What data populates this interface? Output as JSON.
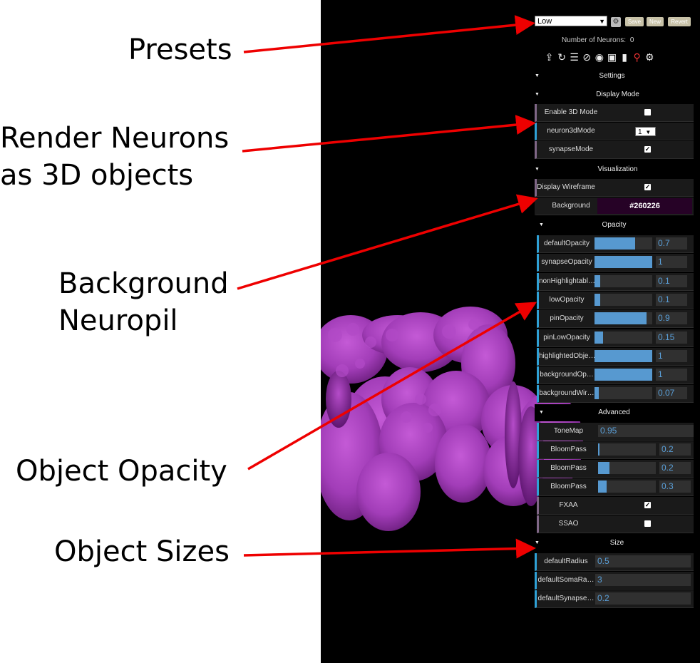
{
  "annotations": {
    "presets": "Presets",
    "render_line1": "Render Neurons",
    "render_line2": "as 3D objects",
    "background_line1": "Background",
    "background_line2": "Neuropil",
    "opacity": "Object Opacity",
    "sizes": "Object Sizes"
  },
  "colors": {
    "arrow": "#ee0000",
    "neuropil": "#a23db8",
    "viewer_bg": "#000000",
    "slider_fill": "#5799d0",
    "number_text": "#5a9fd8"
  },
  "toolbar": {
    "preset_value": "Low",
    "save_label": "Save",
    "new_label": "New",
    "revert_label": "Revert",
    "neuron_count_label": "Number of Neurons:",
    "neuron_count": "0",
    "icons": [
      "upload-icon",
      "refresh-icon",
      "list-icon",
      "eye-slash-icon",
      "eye-icon",
      "camera-icon",
      "trash-icon",
      "unpin-icon",
      "gears-icon"
    ]
  },
  "settings": {
    "title": "Settings",
    "display_mode": {
      "title": "Display Mode",
      "enable_3d_label": "Enable 3D Mode",
      "enable_3d_checked": false,
      "neuron3d_label": "neuron3dMode",
      "neuron3d_value": "1",
      "synapse_label": "synapseMode",
      "synapse_checked": true
    },
    "visualization": {
      "title": "Visualization",
      "wireframe_label": "Display Wireframe",
      "wireframe_checked": true,
      "background_label": "Background",
      "background_value": "#260226",
      "opacity": {
        "title": "Opacity",
        "items": [
          {
            "label": "defaultOpacity",
            "value": "0.7",
            "fill": 0.7
          },
          {
            "label": "synapseOpacity",
            "value": "1",
            "fill": 1
          },
          {
            "label": "nonHighlightabl…",
            "value": "0.1",
            "fill": 0.1
          },
          {
            "label": "lowOpacity",
            "value": "0.1",
            "fill": 0.1
          },
          {
            "label": "pinOpacity",
            "value": "0.9",
            "fill": 0.9
          },
          {
            "label": "pinLowOpacity",
            "value": "0.15",
            "fill": 0.15
          },
          {
            "label": "highlightedObje…",
            "value": "1",
            "fill": 1
          },
          {
            "label": "backgroundOp…",
            "value": "1",
            "fill": 1
          },
          {
            "label": "backgroundWir…",
            "value": "0.07",
            "fill": 0.07
          }
        ]
      },
      "advanced": {
        "title": "Advanced",
        "tonemap_label": "ToneMap",
        "tonemap_value": "0.95",
        "bloom": [
          {
            "label": "BloomPass",
            "value": "0.2",
            "fill": 0.02
          },
          {
            "label": "BloomPass",
            "value": "0.2",
            "fill": 0.2
          },
          {
            "label": "BloomPass",
            "value": "0.3",
            "fill": 0.15
          }
        ],
        "fxaa_label": "FXAA",
        "fxaa_checked": true,
        "ssao_label": "SSAO",
        "ssao_checked": false
      }
    },
    "size": {
      "title": "Size",
      "items": [
        {
          "label": "defaultRadius",
          "value": "0.5"
        },
        {
          "label": "defaultSomaRa…",
          "value": "3"
        },
        {
          "label": "defaultSynapse…",
          "value": "0.2"
        }
      ]
    }
  }
}
